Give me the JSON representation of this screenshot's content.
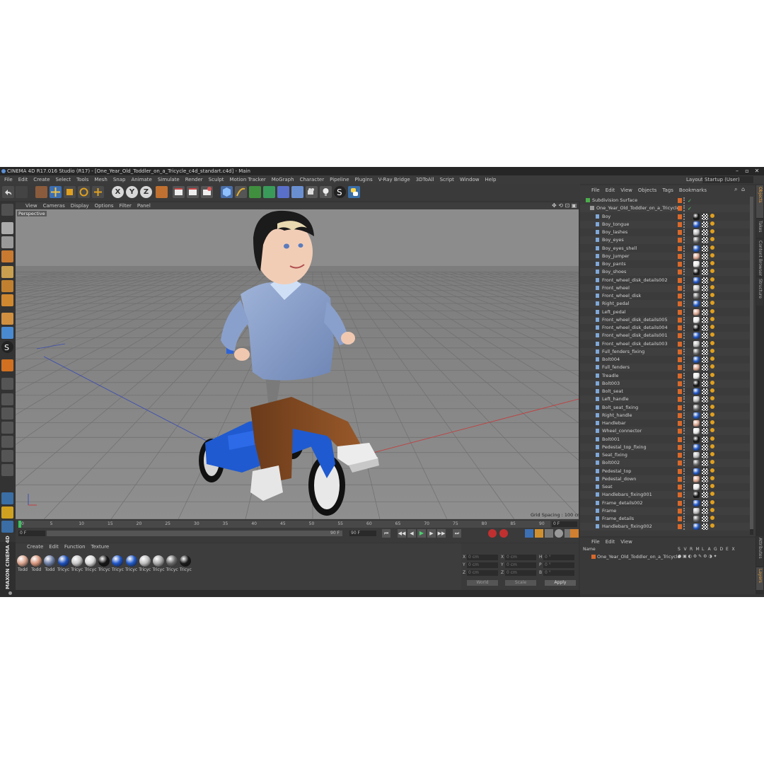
{
  "title": "CINEMA 4D R17.016 Studio (R17) - [One_Year_Old_Toddler_on_a_Tricycle_c4d_standart.c4d] - Main",
  "menu": [
    "File",
    "Edit",
    "Create",
    "Select",
    "Tools",
    "Mesh",
    "Snap",
    "Animate",
    "Simulate",
    "Render",
    "Sculpt",
    "Motion Tracker",
    "MoGraph",
    "Character",
    "Pipeline",
    "Plugins",
    "V-Ray Bridge",
    "3DToAll",
    "Script",
    "Window",
    "Help"
  ],
  "layout_label": "Layout:",
  "layout_value": "Startup (User)",
  "toolbar_axes": [
    "X",
    "Y",
    "Z"
  ],
  "viewport_menu": [
    "View",
    "Cameras",
    "Display",
    "Options",
    "Filter",
    "Panel"
  ],
  "viewport_label": "Perspective",
  "grid_spacing": "Grid Spacing : 100 cm",
  "timeline": {
    "ticks": [
      "0",
      "5",
      "10",
      "15",
      "20",
      "25",
      "30",
      "35",
      "40",
      "45",
      "50",
      "55",
      "60",
      "65",
      "70",
      "75",
      "80",
      "85",
      "90"
    ],
    "current_frame": "0 F",
    "start_frame": "0 F",
    "end_frame": "90 F",
    "end_frame2": "90 F"
  },
  "material_menu": [
    "Create",
    "Edit",
    "Function",
    "Texture"
  ],
  "materials": [
    {
      "label": "Todd",
      "color": "#d9a48e"
    },
    {
      "label": "Todd",
      "color": "#d7967c"
    },
    {
      "label": "Todd",
      "color": "#6e7fa6"
    },
    {
      "label": "Tricyc",
      "color": "#1d4fb8"
    },
    {
      "label": "Tricyc",
      "color": "#c8c8c8"
    },
    {
      "label": "Tricyc",
      "color": "#d9d9d9"
    },
    {
      "label": "Tricyc",
      "color": "#151515"
    },
    {
      "label": "Tricyc",
      "color": "#1f56c9"
    },
    {
      "label": "Tricyc",
      "color": "#2159c7"
    },
    {
      "label": "Tricyc",
      "color": "#bdbdbd"
    },
    {
      "label": "Tricyc",
      "color": "#a9a9a9"
    },
    {
      "label": "Tricyc",
      "color": "#6a6a6a"
    },
    {
      "label": "Tricyc",
      "color": "#1a1a1a"
    }
  ],
  "coords": {
    "labels_left": [
      "X",
      "Y",
      "Z"
    ],
    "labels_mid": [
      "X",
      "Y",
      "Z"
    ],
    "labels_right": [
      "H",
      "P",
      "B"
    ],
    "values_pos": [
      "0 cm",
      "0 cm",
      "0 cm"
    ],
    "values_size": [
      "0 cm",
      "0 cm",
      "0 cm"
    ],
    "values_rot": [
      "0 °",
      "0 °",
      "0 °"
    ],
    "mode1": "World",
    "mode2": "Scale",
    "apply": "Apply"
  },
  "object_menu": [
    "File",
    "Edit",
    "View",
    "Objects",
    "Tags",
    "Bookmarks"
  ],
  "objects": [
    {
      "name": "Subdivision Surface",
      "level": 0
    },
    {
      "name": "One_Year_Old_Toddler_on_a_Tricycle",
      "level": 1
    },
    {
      "name": "Boy",
      "level": 2
    },
    {
      "name": "Boy_tongue",
      "level": 2
    },
    {
      "name": "Boy_lashes",
      "level": 2
    },
    {
      "name": "Boy_eyes",
      "level": 2
    },
    {
      "name": "Boy_eyes_shell",
      "level": 2
    },
    {
      "name": "Boy_jumper",
      "level": 2
    },
    {
      "name": "Boy_pants",
      "level": 2
    },
    {
      "name": "Boy_shoes",
      "level": 2
    },
    {
      "name": "Front_wheel_disk_details002",
      "level": 2
    },
    {
      "name": "Front_wheel",
      "level": 2
    },
    {
      "name": "Front_wheel_disk",
      "level": 2
    },
    {
      "name": "Right_pedal",
      "level": 2
    },
    {
      "name": "Left_pedal",
      "level": 2
    },
    {
      "name": "Front_wheel_disk_details005",
      "level": 2
    },
    {
      "name": "Front_wheel_disk_details004",
      "level": 2
    },
    {
      "name": "Front_wheel_disk_details001",
      "level": 2
    },
    {
      "name": "Front_wheel_disk_details003",
      "level": 2
    },
    {
      "name": "Full_fenders_fixing",
      "level": 2
    },
    {
      "name": "Bolt004",
      "level": 2
    },
    {
      "name": "Full_fenders",
      "level": 2
    },
    {
      "name": "Treadle",
      "level": 2
    },
    {
      "name": "Bolt003",
      "level": 2
    },
    {
      "name": "Bolt_seat",
      "level": 2
    },
    {
      "name": "Left_handle",
      "level": 2
    },
    {
      "name": "Bolt_seat_fixing",
      "level": 2
    },
    {
      "name": "Right_handle",
      "level": 2
    },
    {
      "name": "Handlebar",
      "level": 2
    },
    {
      "name": "Wheel_connector",
      "level": 2
    },
    {
      "name": "Bolt001",
      "level": 2
    },
    {
      "name": "Pedestal_top_fixing",
      "level": 2
    },
    {
      "name": "Seat_fixing",
      "level": 2
    },
    {
      "name": "Bolt002",
      "level": 2
    },
    {
      "name": "Pedestal_top",
      "level": 2
    },
    {
      "name": "Pedestal_down",
      "level": 2
    },
    {
      "name": "Seat",
      "level": 2
    },
    {
      "name": "Handlebars_fixing001",
      "level": 2
    },
    {
      "name": "Frame_details002",
      "level": 2
    },
    {
      "name": "Frame",
      "level": 2
    },
    {
      "name": "Frame_details",
      "level": 2
    },
    {
      "name": "Handlebars_fixing002",
      "level": 2
    }
  ],
  "attr_menu": [
    "File",
    "Edit",
    "View"
  ],
  "attr_headers": [
    "Name",
    "S",
    "V",
    "R",
    "M",
    "L",
    "A",
    "G",
    "D",
    "E",
    "X"
  ],
  "attr_row": "One_Year_Old_Toddler_on_a_Tricycle",
  "side_tabs": [
    "Objects",
    "Takes",
    "Content Browser",
    "Structure",
    "Attributes",
    "Layers"
  ],
  "brand": "MAXON CINEMA 4D"
}
